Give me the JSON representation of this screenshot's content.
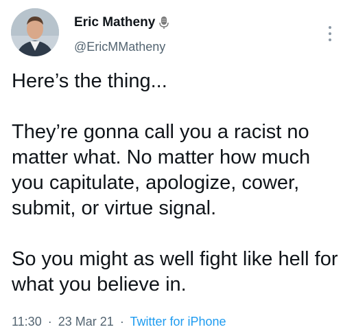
{
  "author": {
    "name": "Eric Matheny",
    "handle": "@EricMMatheny",
    "badge_icon": "microphone-icon"
  },
  "tweet": {
    "paragraphs": [
      "Here’s the thing...",
      "They’re gonna call you a racist no matter what. No matter how much you capitulate, apologize, cower, submit, or virtue signal.",
      "So you might as well fight like hell for what you believe in."
    ]
  },
  "meta": {
    "time": "11:30",
    "separator": "·",
    "date": "23 Mar 21",
    "source": "Twitter for iPhone"
  },
  "colors": {
    "text": "#0f1419",
    "secondary": "#536471",
    "link": "#1d9bf0"
  }
}
